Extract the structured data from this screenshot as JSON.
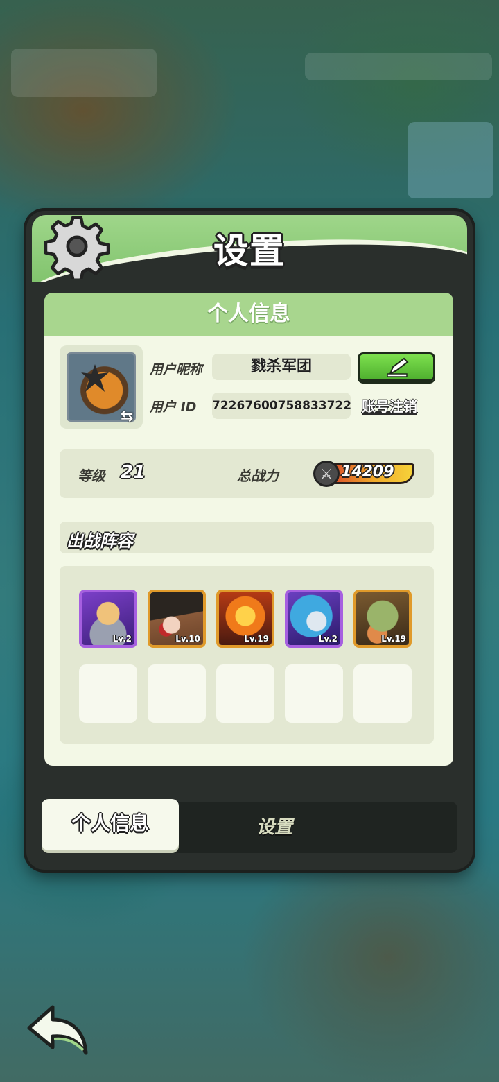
{
  "panel": {
    "title": "设置"
  },
  "profile": {
    "section_title": "个人信息",
    "nickname_label": "用户昵称",
    "nickname": "戮杀军团",
    "id_label": "用户 ID",
    "user_id": "72267600758833722",
    "deregister_label": "账号注销"
  },
  "stats": {
    "level_label": "等级",
    "level": "21",
    "power_label": "总战力",
    "power": "14209"
  },
  "lineup": {
    "title": "出战阵容",
    "heroes": [
      {
        "level": "Lv.2",
        "rarity": "purple",
        "icon": "knight-hero"
      },
      {
        "level": "Lv.10",
        "rarity": "orange",
        "icon": "witch-hero"
      },
      {
        "level": "Lv.19",
        "rarity": "orange",
        "icon": "fire-demon-hero"
      },
      {
        "level": "Lv.2",
        "rarity": "purple",
        "icon": "frost-beast-hero"
      },
      {
        "level": "Lv.19",
        "rarity": "orange",
        "icon": "crocodile-hero"
      }
    ],
    "empty_slots": 5
  },
  "tabs": {
    "active": "个人信息",
    "inactive": "设置"
  },
  "colors": {
    "header_green": "#9fd68a",
    "card_bg": "#f3f8e6",
    "edit_button": "#5fc83a",
    "rarity_purple": "#a65fe0",
    "rarity_orange": "#e09a2a"
  }
}
